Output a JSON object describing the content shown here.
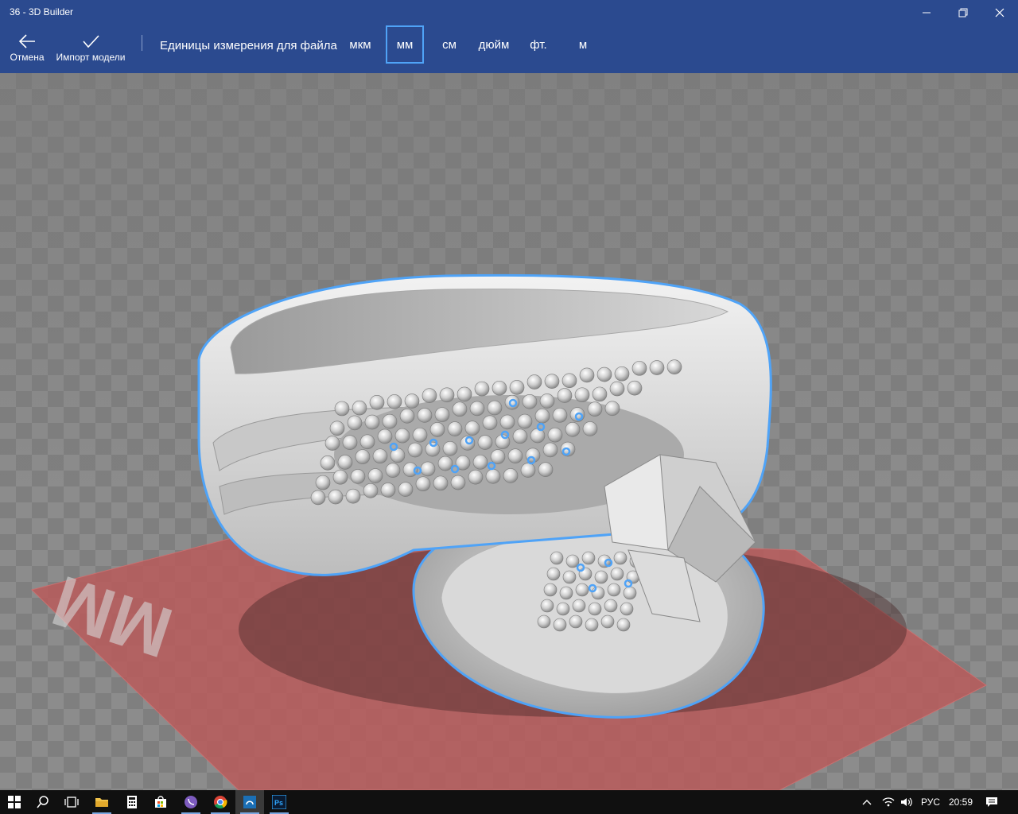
{
  "window": {
    "title": "36 - 3D Builder",
    "minimize_icon": "minimize-icon",
    "restore_icon": "restore-icon",
    "close_icon": "close-icon"
  },
  "commands": {
    "cancel_label": "Отмена",
    "import_label": "Импорт модели"
  },
  "units": {
    "label": "Единицы измерения для файла",
    "options": [
      "мкм",
      "мм",
      "см",
      "дюйм",
      "фт.",
      "м"
    ],
    "selected": "мм"
  },
  "viewport": {
    "plate_label": "MM",
    "model": "ring-model"
  },
  "taskbar": {
    "icons": [
      "windows-start-icon",
      "search-icon",
      "task-view-icon",
      "file-explorer-icon",
      "calculator-icon",
      "store-icon",
      "viber-icon",
      "chrome-icon",
      "3d-builder-icon",
      "photoshop-icon"
    ],
    "tray": {
      "language": "РУС",
      "time": "20:59"
    }
  },
  "colors": {
    "titlebar": "#2b4a8f",
    "selection_outline": "#4fa3f7",
    "build_plate": "#b85a5a"
  }
}
